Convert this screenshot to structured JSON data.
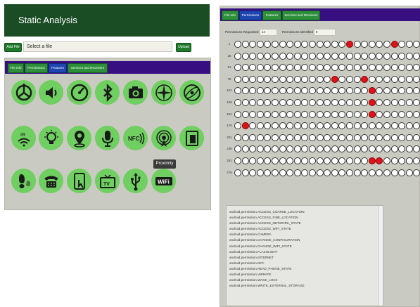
{
  "left": {
    "title": "Static Analysis",
    "add_file_label": "Add File",
    "file_input_value": "Select a file",
    "upload_label": "Upload",
    "tabs": [
      {
        "label": "File Info",
        "active": false
      },
      {
        "label": "Permissions",
        "active": false
      },
      {
        "label": "Features",
        "active": true
      },
      {
        "label": "Services and Receivers",
        "active": false
      }
    ],
    "feature_icons": [
      {
        "icon": "accelerometer-icon",
        "label": ""
      },
      {
        "icon": "speaker-icon",
        "label": ""
      },
      {
        "icon": "compass-icon",
        "label": ""
      },
      {
        "icon": "bluetooth-icon",
        "label": ""
      },
      {
        "icon": "camera-icon",
        "label": ""
      },
      {
        "icon": "compass-rose-icon",
        "label": ""
      },
      {
        "icon": "gyroscope-icon",
        "label": ""
      },
      {
        "icon": "infrared-icon",
        "label": "IR"
      },
      {
        "icon": "light-sensor-icon",
        "label": ""
      },
      {
        "icon": "location-icon",
        "label": ""
      },
      {
        "icon": "microphone-icon",
        "label": ""
      },
      {
        "icon": "nfc-icon",
        "label": "NFC"
      },
      {
        "icon": "proximity-icon",
        "label": ""
      },
      {
        "icon": "screen-icon",
        "label": ""
      },
      {
        "icon": "step-counter-icon",
        "label": ""
      },
      {
        "icon": "telephony-icon",
        "label": ""
      },
      {
        "icon": "touchscreen-icon",
        "label": ""
      },
      {
        "icon": "television-icon",
        "label": "TV"
      },
      {
        "icon": "usb-icon",
        "label": ""
      },
      {
        "icon": "wifi-icon",
        "label": "WiFi"
      }
    ],
    "tooltip": "Proximity"
  },
  "right": {
    "tabs": [
      {
        "label": "File Info",
        "active": false
      },
      {
        "label": "Permissions",
        "active": true
      },
      {
        "label": "Features",
        "active": false
      },
      {
        "label": "Services and Receivers",
        "active": false
      }
    ],
    "permissions_requested_label": "Permissions Requested",
    "permissions_requested_value": "14",
    "permissions_identified_label": "Permissions Identified",
    "permissions_identified_value": "9",
    "grid": {
      "columns": 25,
      "row_labels": [
        "1",
        "26",
        "51",
        "76",
        "101",
        "126",
        "151",
        "176",
        "201",
        "226",
        "251",
        "276"
      ],
      "active_cells": [
        [
          0,
          15
        ],
        [
          0,
          21
        ],
        [
          3,
          13
        ],
        [
          3,
          17
        ],
        [
          4,
          18
        ],
        [
          5,
          18
        ],
        [
          6,
          18
        ],
        [
          7,
          1
        ],
        [
          10,
          18
        ],
        [
          10,
          19
        ]
      ]
    },
    "permissions": [
      "android.permission.ACCESS_COARSE_LOCATION",
      "android.permission.ACCESS_FINE_LOCATION",
      "android.permission.ACCESS_NETWORK_STATE",
      "android.permission.ACCESS_WIFI_STATE",
      "android.permission.CAMERA",
      "android.permission.CHANGE_CONFIGURATION",
      "android.permission.CHANGE_WIFI_STATE",
      "android.permission.FLASHLIGHT",
      "android.permission.INTERNET",
      "android.permission.NFC",
      "android.permission.READ_PHONE_STATE",
      "android.permission.VIBRATE",
      "android.permission.WAKE_LOCK",
      "android.permission.WRITE_EXTERNAL_STORAGE"
    ]
  },
  "colors": {
    "title_bar": "#1b4d24",
    "tab_bar": "#380f80",
    "tab": "#2d8f3a",
    "tab_active": "#1e46b0",
    "icon_circle": "#6fcf60",
    "panel": "#c9cac1",
    "active_cell": "#e0121a"
  }
}
